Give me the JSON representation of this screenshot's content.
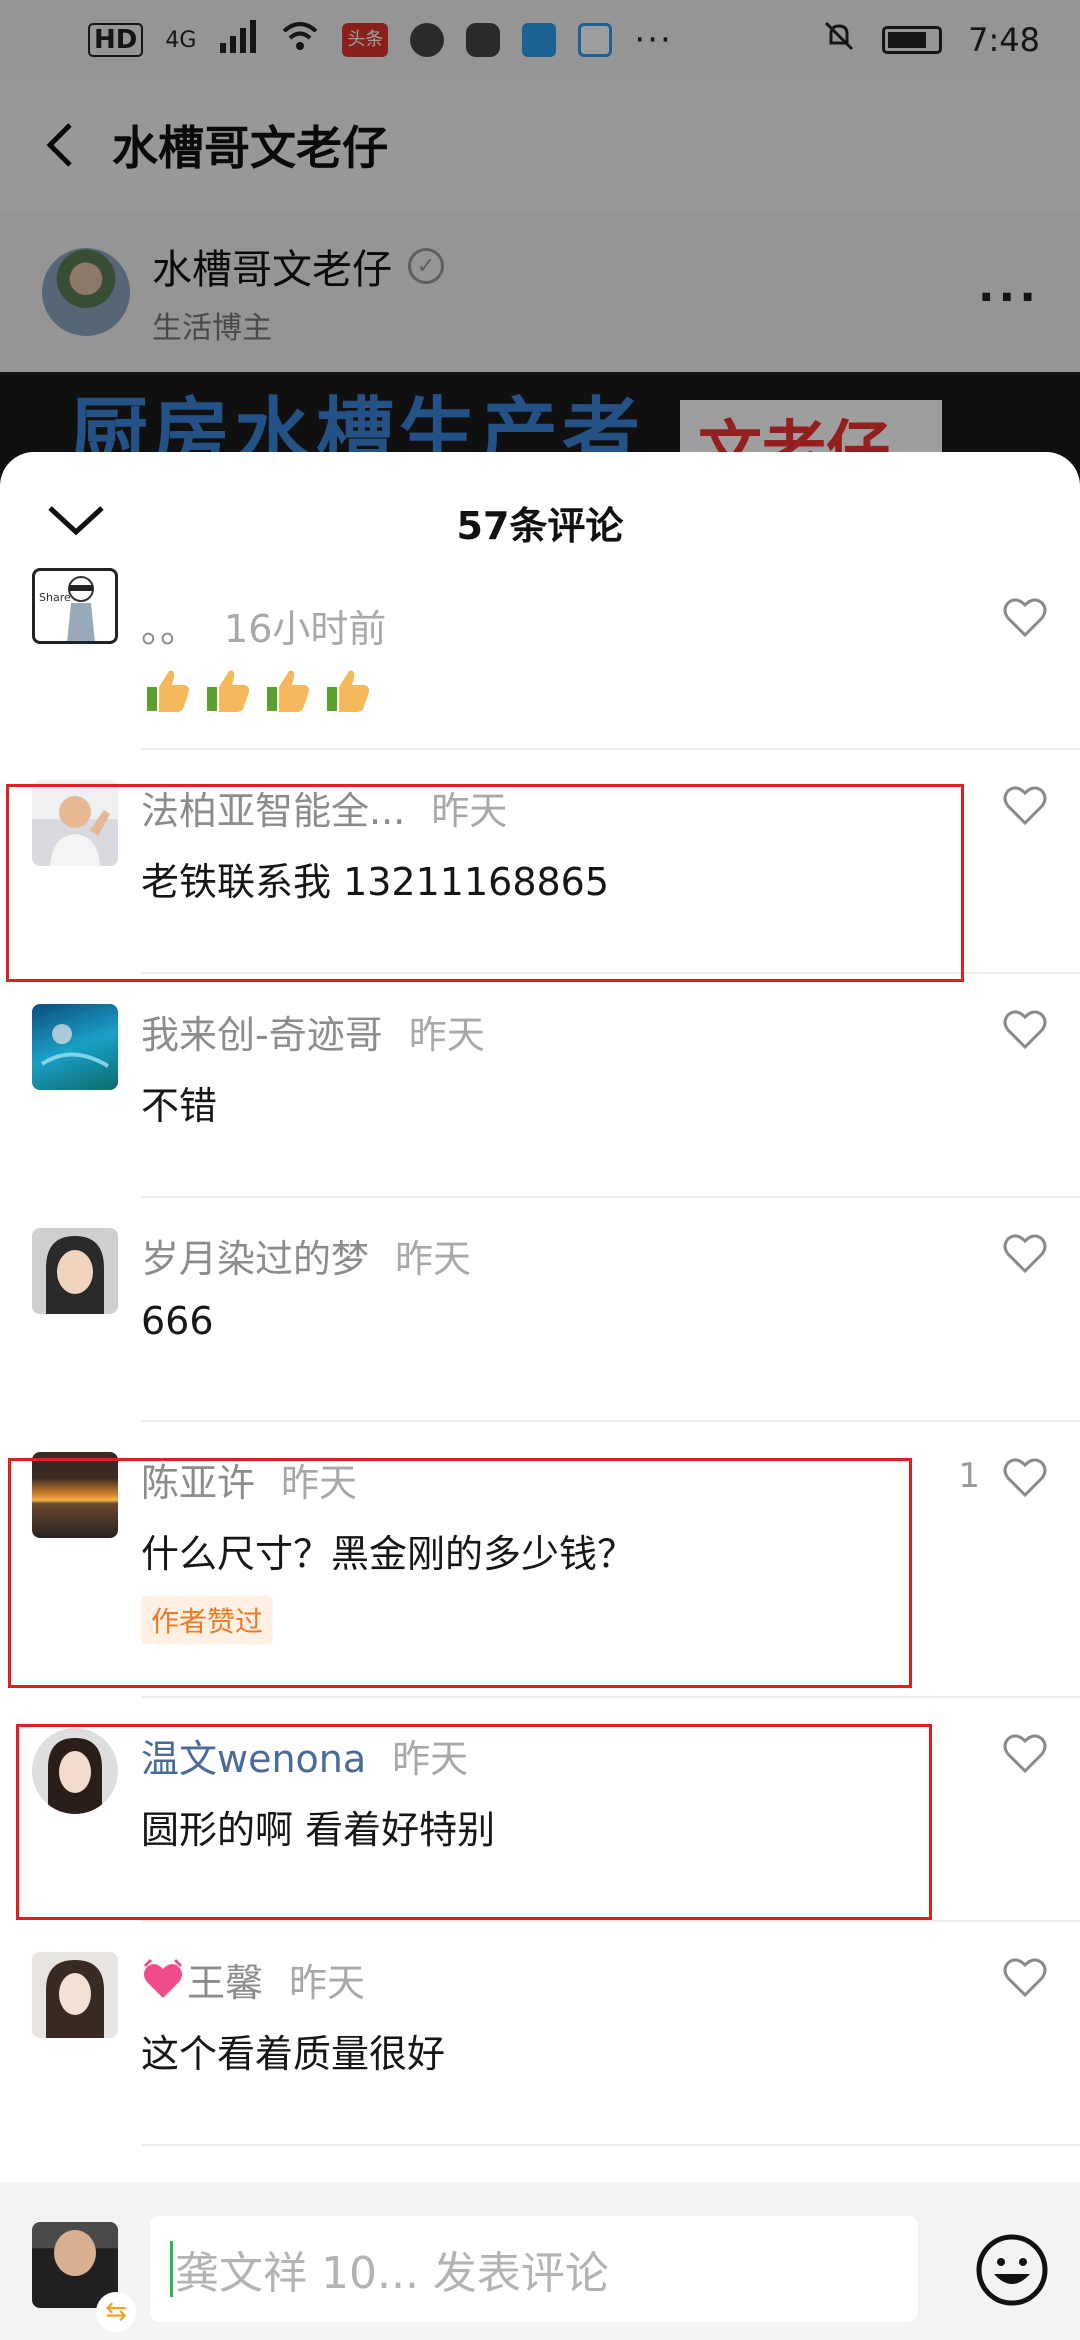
{
  "status_bar": {
    "time": "7:48",
    "network": "4G",
    "hd": "HD",
    "news_app": "头条"
  },
  "nav": {
    "title": "水槽哥文老仔"
  },
  "author": {
    "name": "水槽哥文老仔",
    "subtitle": "生活博主"
  },
  "video": {
    "banner_text": "厨房水槽生产者",
    "tag_text": "文老仔"
  },
  "sheet": {
    "title": "57条评论"
  },
  "comments": [
    {
      "author": "。。",
      "time": "16小时前",
      "text": "",
      "emoji": "thumbs-up x4"
    },
    {
      "author": "法柏亚智能全...",
      "time": "昨天",
      "text": "老铁联系我 13211168865"
    },
    {
      "author": "我来创-奇迹哥",
      "time": "昨天",
      "text": "不错"
    },
    {
      "author": "岁月染过的梦",
      "time": "昨天",
      "text": "666"
    },
    {
      "author": "陈亚许",
      "time": "昨天",
      "text": "什么尺寸？黑金刚的多少钱？",
      "badge": "作者赞过",
      "likes": "1"
    },
    {
      "author": "温文wenona",
      "time": "昨天",
      "text": "圆形的啊 看着好特别"
    },
    {
      "author": "王馨",
      "time": "昨天",
      "text": "这个看着质量很好"
    }
  ],
  "input": {
    "placeholder": "龚文祥 10... 发表评论"
  },
  "colors": {
    "highlight": "#e02020",
    "badge_text": "#f07a24",
    "badge_bg": "#fff0e4",
    "caret": "#2db84a"
  }
}
